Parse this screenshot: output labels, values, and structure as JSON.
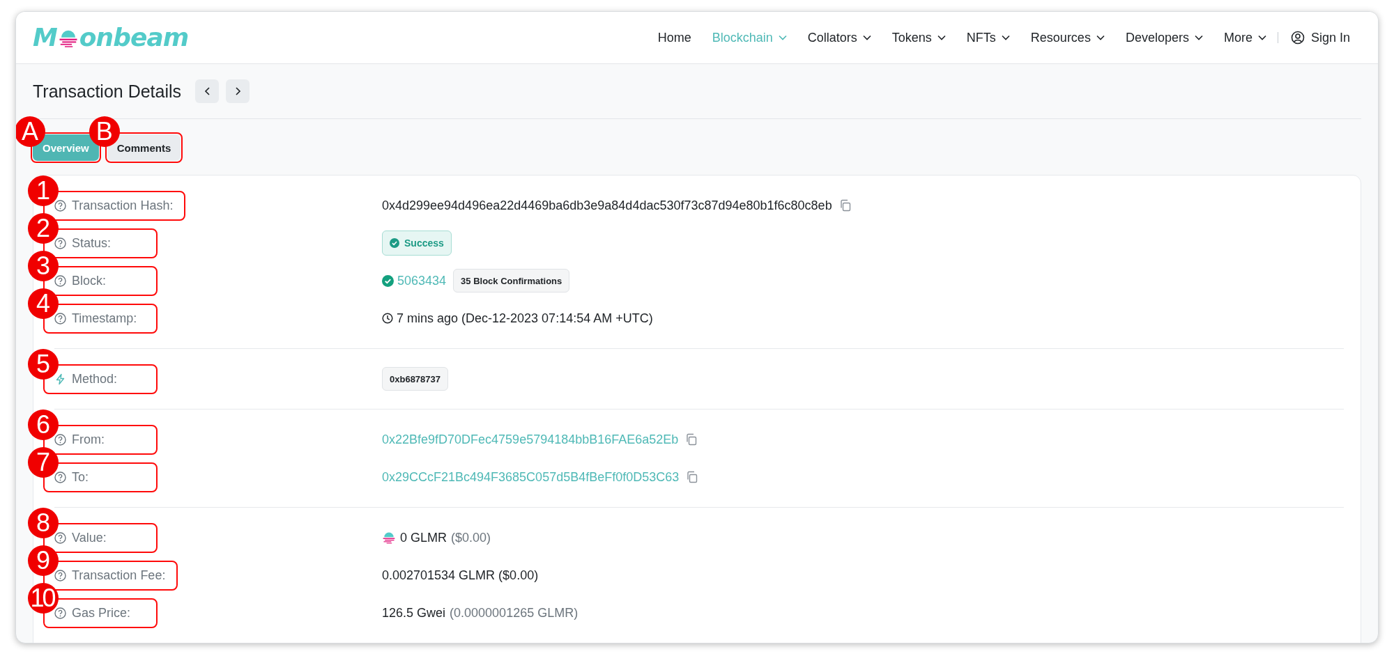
{
  "header": {
    "logo": {
      "before": "M",
      "after": "onbeam"
    },
    "nav": [
      {
        "label": "Home",
        "selected": false,
        "dropdown": false
      },
      {
        "label": "Blockchain",
        "selected": true,
        "dropdown": true
      },
      {
        "label": "Collators",
        "selected": false,
        "dropdown": true
      },
      {
        "label": "Tokens",
        "selected": false,
        "dropdown": true
      },
      {
        "label": "NFTs",
        "selected": false,
        "dropdown": true
      },
      {
        "label": "Resources",
        "selected": false,
        "dropdown": true
      },
      {
        "label": "Developers",
        "selected": false,
        "dropdown": true
      },
      {
        "label": "More",
        "selected": false,
        "dropdown": true
      }
    ],
    "sign_in": "Sign In"
  },
  "page_title": "Transaction Details",
  "tabs": [
    {
      "label": "Overview",
      "selected": true,
      "annotation": "A"
    },
    {
      "label": "Comments",
      "selected": false,
      "annotation": "B"
    }
  ],
  "sections": [
    {
      "rows": [
        {
          "label": "Transaction Hash:",
          "kind": "info",
          "annotation": "1",
          "value": {
            "kind": "text",
            "text": "0x4d299ee94d496ea22d4469ba6db3e9a84d4dac530f73c87d94e80b1f6c80c8eb",
            "copy": true
          }
        },
        {
          "label": "Status:",
          "kind": "info",
          "annotation": "2",
          "value": {
            "kind": "status",
            "text": "Success"
          }
        },
        {
          "label": "Block:",
          "kind": "info",
          "annotation": "3",
          "value": {
            "kind": "block",
            "text": "5063434",
            "badge": "35 Block Confirmations"
          }
        },
        {
          "label": "Timestamp:",
          "kind": "info",
          "annotation": "4",
          "value": {
            "kind": "time",
            "text": "7 mins ago (Dec-12-2023 07:14:54 AM +UTC)"
          }
        }
      ]
    },
    {
      "rows": [
        {
          "label": "Method:",
          "kind": "method",
          "annotation": "5",
          "value": {
            "kind": "badge",
            "text": "0xb6878737"
          }
        }
      ]
    },
    {
      "rows": [
        {
          "label": "From:",
          "kind": "info",
          "annotation": "6",
          "value": {
            "kind": "link",
            "text": "0x22Bfe9fD70DFec4759e5794184bbB16FAE6a52Eb",
            "copy": true
          }
        },
        {
          "label": "To:",
          "kind": "info",
          "annotation": "7",
          "value": {
            "kind": "link",
            "text": "0x29CCcF21Bc494F3685C057d5B4fBeFf0f0D53C63",
            "copy": true
          }
        }
      ]
    },
    {
      "rows": [
        {
          "label": "Value:",
          "kind": "info",
          "annotation": "8",
          "value": {
            "kind": "token",
            "text": "0 GLMR",
            "note": "($0.00)"
          }
        },
        {
          "label": "Transaction Fee:",
          "kind": "info",
          "annotation": "9",
          "value": {
            "kind": "text",
            "text": "0.002701534 GLMR ($0.00)"
          }
        },
        {
          "label": "Gas Price:",
          "kind": "info",
          "annotation": "10",
          "value": {
            "kind": "text",
            "text": "126.5 Gwei",
            "note": "(0.0000001265 GLMR)"
          }
        }
      ]
    }
  ]
}
